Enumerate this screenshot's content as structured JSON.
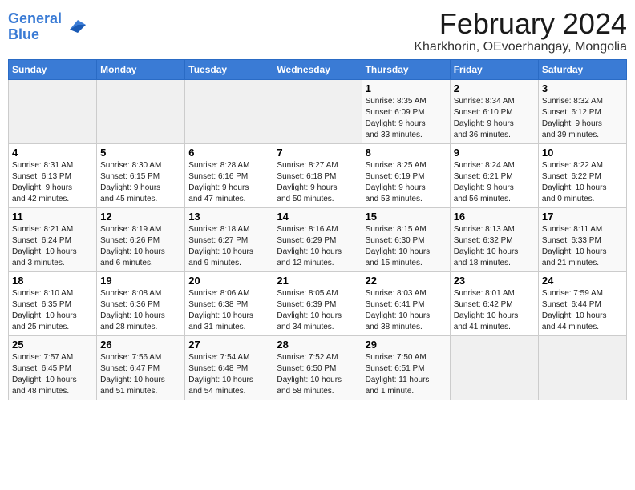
{
  "logo": {
    "line1": "General",
    "line2": "Blue"
  },
  "title": "February 2024",
  "subtitle": "Kharkhorin, OEvoerhangay, Mongolia",
  "weekdays": [
    "Sunday",
    "Monday",
    "Tuesday",
    "Wednesday",
    "Thursday",
    "Friday",
    "Saturday"
  ],
  "weeks": [
    [
      {
        "day": "",
        "detail": ""
      },
      {
        "day": "",
        "detail": ""
      },
      {
        "day": "",
        "detail": ""
      },
      {
        "day": "",
        "detail": ""
      },
      {
        "day": "1",
        "detail": "Sunrise: 8:35 AM\nSunset: 6:09 PM\nDaylight: 9 hours\nand 33 minutes."
      },
      {
        "day": "2",
        "detail": "Sunrise: 8:34 AM\nSunset: 6:10 PM\nDaylight: 9 hours\nand 36 minutes."
      },
      {
        "day": "3",
        "detail": "Sunrise: 8:32 AM\nSunset: 6:12 PM\nDaylight: 9 hours\nand 39 minutes."
      }
    ],
    [
      {
        "day": "4",
        "detail": "Sunrise: 8:31 AM\nSunset: 6:13 PM\nDaylight: 9 hours\nand 42 minutes."
      },
      {
        "day": "5",
        "detail": "Sunrise: 8:30 AM\nSunset: 6:15 PM\nDaylight: 9 hours\nand 45 minutes."
      },
      {
        "day": "6",
        "detail": "Sunrise: 8:28 AM\nSunset: 6:16 PM\nDaylight: 9 hours\nand 47 minutes."
      },
      {
        "day": "7",
        "detail": "Sunrise: 8:27 AM\nSunset: 6:18 PM\nDaylight: 9 hours\nand 50 minutes."
      },
      {
        "day": "8",
        "detail": "Sunrise: 8:25 AM\nSunset: 6:19 PM\nDaylight: 9 hours\nand 53 minutes."
      },
      {
        "day": "9",
        "detail": "Sunrise: 8:24 AM\nSunset: 6:21 PM\nDaylight: 9 hours\nand 56 minutes."
      },
      {
        "day": "10",
        "detail": "Sunrise: 8:22 AM\nSunset: 6:22 PM\nDaylight: 10 hours\nand 0 minutes."
      }
    ],
    [
      {
        "day": "11",
        "detail": "Sunrise: 8:21 AM\nSunset: 6:24 PM\nDaylight: 10 hours\nand 3 minutes."
      },
      {
        "day": "12",
        "detail": "Sunrise: 8:19 AM\nSunset: 6:26 PM\nDaylight: 10 hours\nand 6 minutes."
      },
      {
        "day": "13",
        "detail": "Sunrise: 8:18 AM\nSunset: 6:27 PM\nDaylight: 10 hours\nand 9 minutes."
      },
      {
        "day": "14",
        "detail": "Sunrise: 8:16 AM\nSunset: 6:29 PM\nDaylight: 10 hours\nand 12 minutes."
      },
      {
        "day": "15",
        "detail": "Sunrise: 8:15 AM\nSunset: 6:30 PM\nDaylight: 10 hours\nand 15 minutes."
      },
      {
        "day": "16",
        "detail": "Sunrise: 8:13 AM\nSunset: 6:32 PM\nDaylight: 10 hours\nand 18 minutes."
      },
      {
        "day": "17",
        "detail": "Sunrise: 8:11 AM\nSunset: 6:33 PM\nDaylight: 10 hours\nand 21 minutes."
      }
    ],
    [
      {
        "day": "18",
        "detail": "Sunrise: 8:10 AM\nSunset: 6:35 PM\nDaylight: 10 hours\nand 25 minutes."
      },
      {
        "day": "19",
        "detail": "Sunrise: 8:08 AM\nSunset: 6:36 PM\nDaylight: 10 hours\nand 28 minutes."
      },
      {
        "day": "20",
        "detail": "Sunrise: 8:06 AM\nSunset: 6:38 PM\nDaylight: 10 hours\nand 31 minutes."
      },
      {
        "day": "21",
        "detail": "Sunrise: 8:05 AM\nSunset: 6:39 PM\nDaylight: 10 hours\nand 34 minutes."
      },
      {
        "day": "22",
        "detail": "Sunrise: 8:03 AM\nSunset: 6:41 PM\nDaylight: 10 hours\nand 38 minutes."
      },
      {
        "day": "23",
        "detail": "Sunrise: 8:01 AM\nSunset: 6:42 PM\nDaylight: 10 hours\nand 41 minutes."
      },
      {
        "day": "24",
        "detail": "Sunrise: 7:59 AM\nSunset: 6:44 PM\nDaylight: 10 hours\nand 44 minutes."
      }
    ],
    [
      {
        "day": "25",
        "detail": "Sunrise: 7:57 AM\nSunset: 6:45 PM\nDaylight: 10 hours\nand 48 minutes."
      },
      {
        "day": "26",
        "detail": "Sunrise: 7:56 AM\nSunset: 6:47 PM\nDaylight: 10 hours\nand 51 minutes."
      },
      {
        "day": "27",
        "detail": "Sunrise: 7:54 AM\nSunset: 6:48 PM\nDaylight: 10 hours\nand 54 minutes."
      },
      {
        "day": "28",
        "detail": "Sunrise: 7:52 AM\nSunset: 6:50 PM\nDaylight: 10 hours\nand 58 minutes."
      },
      {
        "day": "29",
        "detail": "Sunrise: 7:50 AM\nSunset: 6:51 PM\nDaylight: 11 hours\nand 1 minute."
      },
      {
        "day": "",
        "detail": ""
      },
      {
        "day": "",
        "detail": ""
      }
    ]
  ]
}
